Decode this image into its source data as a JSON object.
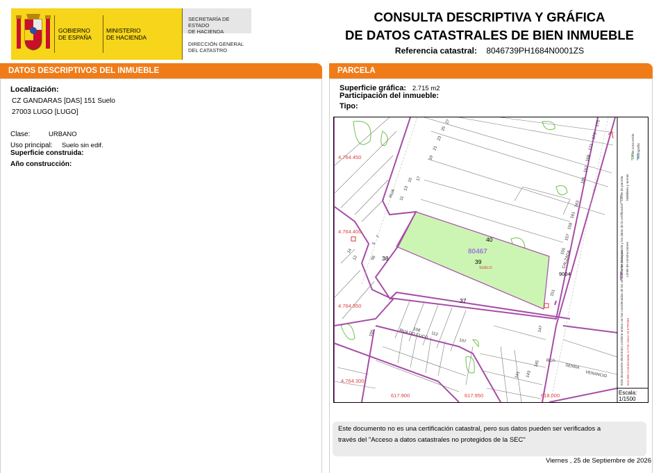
{
  "header": {
    "gov_line1": "GOBIERNO",
    "gov_line2": "DE ESPAÑA",
    "min_line1": "MINISTERIO",
    "min_line2": "DE HACIENDA",
    "sec_line1": "SECRETARÍA DE ESTADO",
    "sec_line2": "DE HACIENDA",
    "dg_line1": "DIRECCIÓN GENERAL",
    "dg_line2": "DEL CATASTRO",
    "title_line1": "CONSULTA DESCRIPTIVA Y GRÁFICA",
    "title_line2": "DE DATOS CATASTRALES DE BIEN INMUEBLE",
    "ref_label": "Referencia catastral:",
    "ref_value": "8046739PH1684N0001ZS"
  },
  "left": {
    "bar_title": "DATOS DESCRIPTIVOS DEL INMUEBLE",
    "localizacion_label": "Localización:",
    "address_line1": "CZ GANDARAS [DAS] 151 Suelo",
    "address_line2": "27003 LUGO [LUGO]",
    "clase_label": "Clase:",
    "clase_value": "URBANO",
    "uso_label": "Uso principal:",
    "uso_value": "Suelo sin edif.",
    "superficie_label": "Superficie construida:",
    "anio_label": "Año construcción:"
  },
  "right": {
    "bar_title": "PARCELA",
    "superficie_label": "Superficie gráfica:",
    "superficie_value": "2.715 m2",
    "participacion_label": "Participación del inmueble:",
    "tipo_label": "Tipo:"
  },
  "map": {
    "coord_labels": {
      "y1": "4.764.450",
      "y2": "4.764.400",
      "y3": "4.764.350",
      "y4": "4.764.300",
      "x1": "617.900",
      "x2": "617.950",
      "x3": "618.000"
    },
    "parcel_id": "80467",
    "parcel_sub": "39",
    "parcel_type": "SUELO",
    "labels": {
      "n40": "40",
      "n38": "38",
      "n37": "37",
      "n9004": "9004",
      "rua": "RUA",
      "calzada": "CALZADA",
      "rua_do_cuco": "RUA DO CUCO",
      "rua2": "RUA",
      "senra": "SENRA",
      "venancio": "VENANCIO",
      "n66": "66",
      "n5": "5",
      "n7": "7",
      "n14": "14",
      "n12": "12",
      "n151": "151",
      "n147": "147",
      "n145": "145",
      "n143": "143",
      "n141": "141",
      "n155": "155",
      "n157": "157",
      "n159": "159",
      "n161": "161",
      "n163": "163",
      "n107": "107",
      "n112": "112",
      "n108": "108",
      "n105": "105",
      "n11": "11",
      "n13": "13",
      "n15": "15",
      "n17": "17",
      "n19": "19",
      "n21": "21",
      "n23": "23",
      "n25": "25",
      "n27": "27",
      "n175": "175",
      "n173": "173",
      "n171": "171",
      "n169": "169",
      "n165": "165",
      "n167": "167"
    },
    "legend": {
      "limite_manzana": "Límite de manzana",
      "limite_parcela": "Límite de parcela",
      "limite_construcciones": "Límite de construcciones",
      "mobiliario": "Mobiliario y aceras",
      "limite_zona_verde": "Límite zona verde",
      "hidrografia": "Hidrografía",
      "coords_note": "618.050 Coordenadas U.T.M. Huso 29 ETRS89",
      "doc_note": "Este documento electrónico contiene anexo con las coordenadas de los vértices UTM de la parcela y los datos de la certificación"
    },
    "scale_label": "Escala:",
    "scale_value": "1/1500"
  },
  "footer": {
    "note_line1": "Este documento no es una certificación catastral, pero sus datos pueden ser verificados a",
    "note_line2": "través del \"Acceso a datos catastrales no protegidos de la SEC\"",
    "date": "Viernes , 25 de Septiembre de 2026"
  },
  "colors": {
    "orange": "#f07c19",
    "yellow": "#f6d51a",
    "parcel_fill": "#ccf5b3",
    "block_line": "#9b59b6",
    "green_line": "#4caf50"
  }
}
